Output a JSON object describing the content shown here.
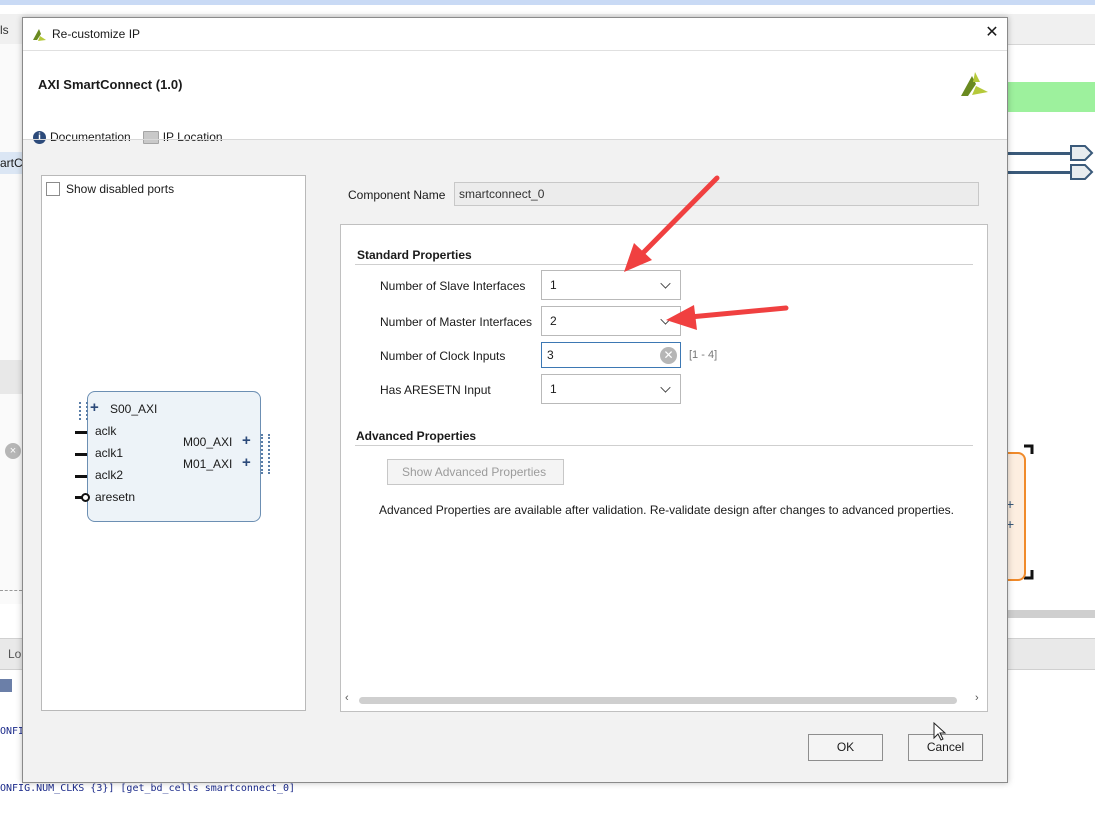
{
  "background": {
    "left_tab_fragment": "ls",
    "left_selected_fragment": "artCo",
    "tab_fragment": "Lo",
    "log_line_1": "ONFI",
    "log_line_2": "ONFIG.NUM_CLKS {3}] [get_bd_cells smartconnect_0]"
  },
  "dialog": {
    "title": "Re-customize IP",
    "ip_title": "AXI SmartConnect (1.0)",
    "links": {
      "documentation": "Documentation",
      "ip_location": "IP Location"
    },
    "preview": {
      "show_disabled_ports": "Show disabled ports",
      "show_disabled_ports_checked": false,
      "block": {
        "slave_port": "S00_AXI",
        "inputs": [
          "aclk",
          "aclk1",
          "aclk2",
          "aresetn"
        ],
        "master_ports": [
          "M00_AXI",
          "M01_AXI"
        ]
      }
    },
    "component_name": {
      "label": "Component Name",
      "value": "smartconnect_0"
    },
    "standard_properties": {
      "title": "Standard Properties",
      "slave_interfaces": {
        "label": "Number of Slave Interfaces",
        "value": "1"
      },
      "master_interfaces": {
        "label": "Number of Master Interfaces",
        "value": "2"
      },
      "clock_inputs": {
        "label": "Number of Clock Inputs",
        "value": "3",
        "range": "[1 - 4]"
      },
      "aresetn_input": {
        "label": "Has ARESETN Input",
        "value": "1"
      }
    },
    "advanced_properties": {
      "title": "Advanced Properties",
      "button": "Show Advanced Properties",
      "note": "Advanced Properties are available after validation. Re-validate design after changes to advanced properties."
    },
    "buttons": {
      "ok": "OK",
      "cancel": "Cancel"
    }
  },
  "colors": {
    "annotation_arrow": "#f04040",
    "vivado_logo": "#b5c93a",
    "block_border": "#6c8fb3"
  }
}
